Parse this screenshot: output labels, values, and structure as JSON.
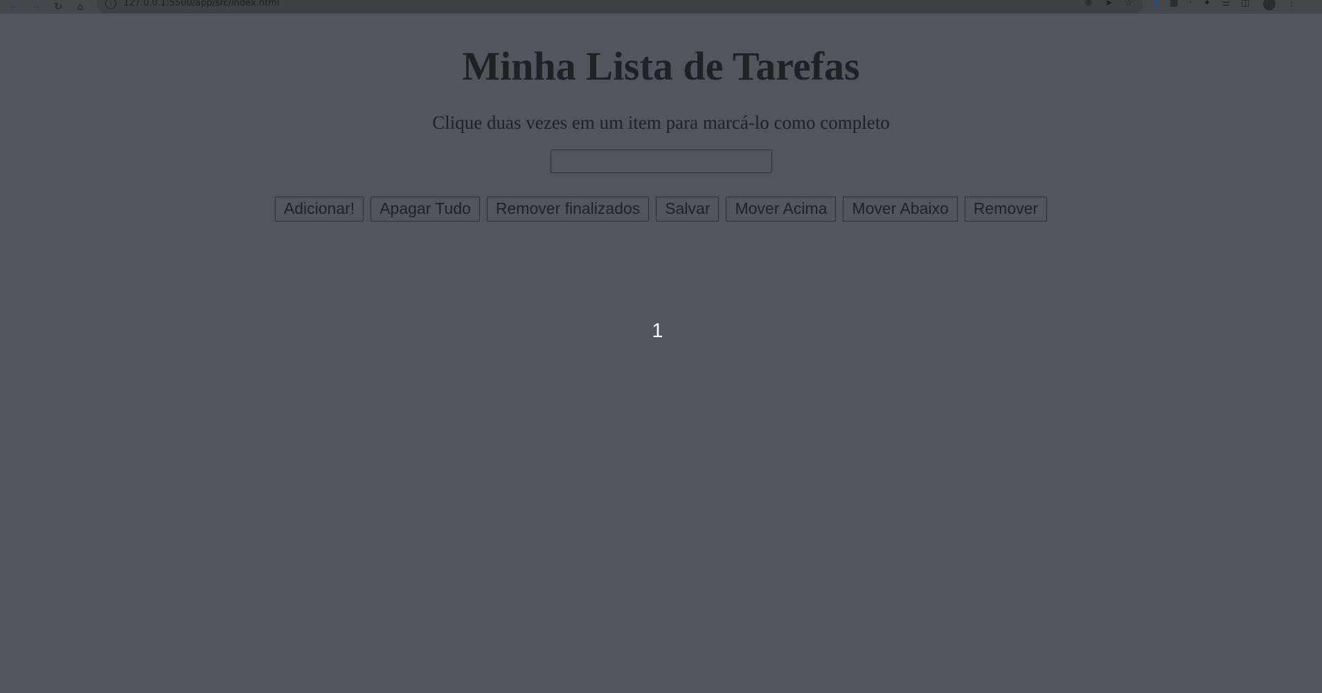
{
  "browser": {
    "url": "127.0.0.1:5500/app/src/index.html"
  },
  "page": {
    "title": "Minha Lista de Tarefas",
    "subtitle": "Clique duas vezes em um item para marcá-lo como completo",
    "input_value": ""
  },
  "buttons": {
    "add": "Adicionar!",
    "clear_all": "Apagar Tudo",
    "remove_done": "Remover finalizados",
    "save": "Salvar",
    "move_up": "Mover Acima",
    "move_down": "Mover Abaixo",
    "remove": "Remover"
  },
  "tasks": [
    "1"
  ],
  "colors": {
    "overlay_background": "#51555e",
    "text": "#1e2126",
    "task_text": "#ffffff"
  }
}
